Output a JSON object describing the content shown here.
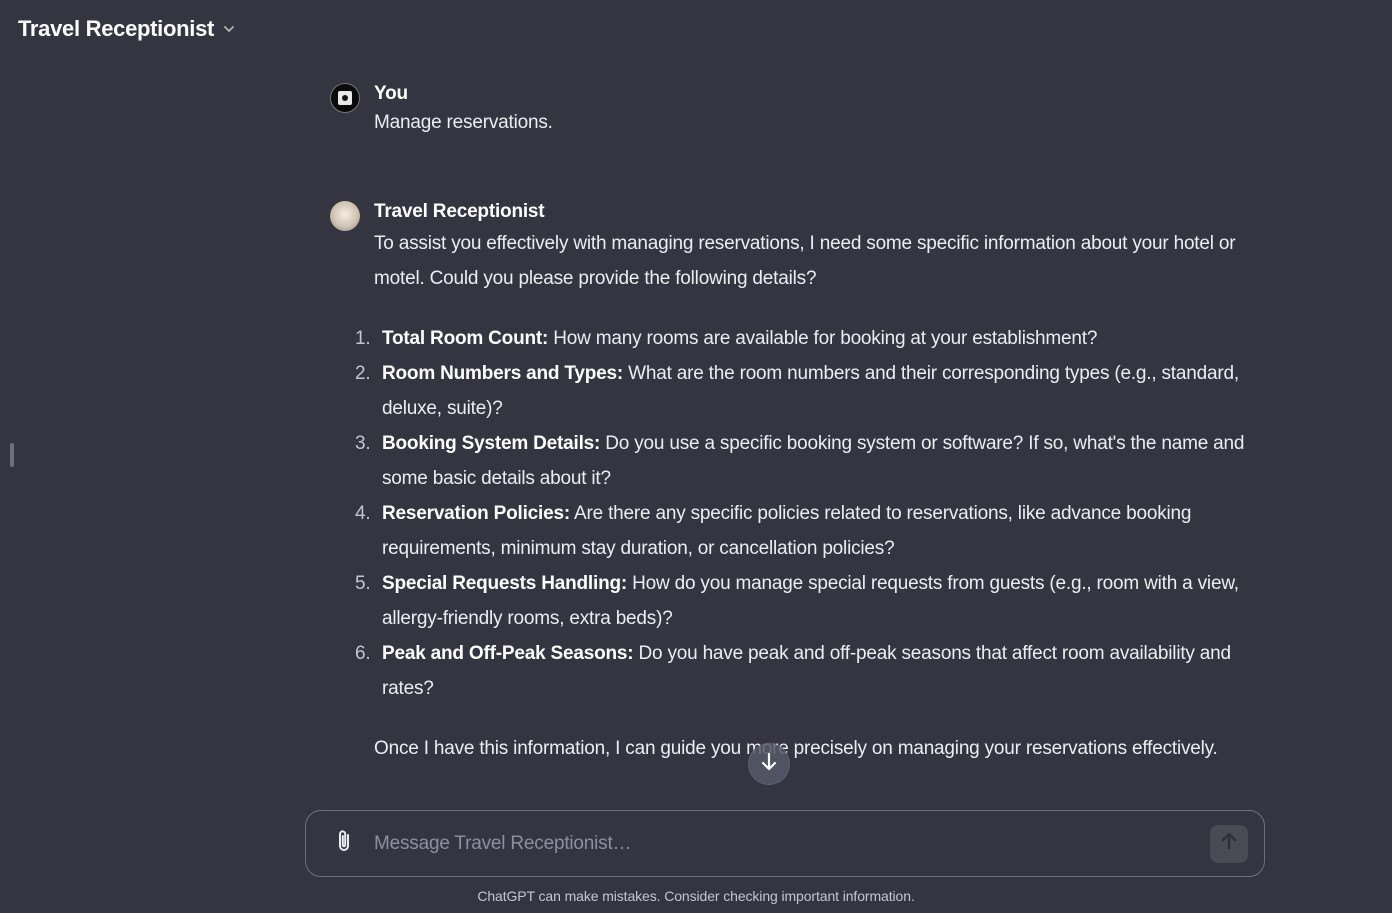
{
  "header": {
    "title": "Travel Receptionist"
  },
  "messages": {
    "user": {
      "author": "You",
      "text": "Manage reservations."
    },
    "bot": {
      "author": "Travel Receptionist",
      "intro": "To assist you effectively with managing reservations, I need some specific information about your hotel or motel. Could you please provide the following details?",
      "items": [
        {
          "num": "1.",
          "title": "Total Room Count:",
          "text": " How many rooms are available for booking at your establishment?"
        },
        {
          "num": "2.",
          "title": "Room Numbers and Types:",
          "text": " What are the room numbers and their corresponding types (e.g., standard, deluxe, suite)?"
        },
        {
          "num": "3.",
          "title": "Booking System Details:",
          "text": " Do you use a specific booking system or software? If so, what's the name and some basic details about it?"
        },
        {
          "num": "4.",
          "title": "Reservation Policies:",
          "text": " Are there any specific policies related to reservations, like advance booking requirements, minimum stay duration, or cancellation policies?"
        },
        {
          "num": "5.",
          "title": "Special Requests Handling:",
          "text": " How do you manage special requests from guests (e.g., room with a view, allergy-friendly rooms, extra beds)?"
        },
        {
          "num": "6.",
          "title": "Peak and Off-Peak Seasons:",
          "text": " Do you have peak and off-peak seasons that affect room availability and rates?"
        }
      ],
      "outro": "Once I have this information, I can guide you more precisely on managing your reservations effectively."
    }
  },
  "composer": {
    "placeholder": "Message Travel Receptionist…"
  },
  "footer": {
    "disclaimer": "ChatGPT can make mistakes. Consider checking important information."
  },
  "icons": {
    "chevron": "chevron-down-icon",
    "attach": "paperclip-icon",
    "send": "arrow-up-icon",
    "scroll": "arrow-down-icon"
  }
}
